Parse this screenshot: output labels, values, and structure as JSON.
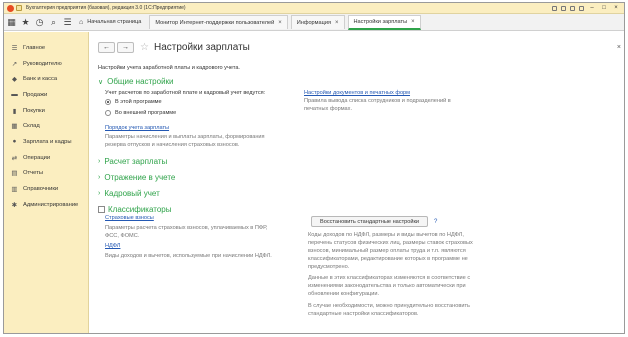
{
  "window": {
    "title": "Бухгалтерия предприятия (базовая), редакция 3.0  (1С:Предприятие)",
    "controls": [
      "–",
      "□",
      "×"
    ]
  },
  "toolbar": {
    "tabs": [
      {
        "label": "Начальная страница",
        "closable": false
      },
      {
        "label": "Монитор Интернет-поддержки пользователей",
        "closable": true
      },
      {
        "label": "Информация",
        "closable": true
      },
      {
        "label": "Настройки зарплаты",
        "closable": true,
        "active": true
      }
    ],
    "close_glyph": "×"
  },
  "sidebar": {
    "items": [
      {
        "label": "Главное",
        "icon": "menu-icon",
        "glyph": "☰"
      },
      {
        "label": "Руководителю",
        "icon": "chart-icon",
        "glyph": "↗"
      },
      {
        "label": "Банк и касса",
        "icon": "bank-icon",
        "glyph": "◆"
      },
      {
        "label": "Продажи",
        "icon": "cart-icon",
        "glyph": "▬"
      },
      {
        "label": "Покупки",
        "icon": "basket-icon",
        "glyph": "▮"
      },
      {
        "label": "Склад",
        "icon": "warehouse-icon",
        "glyph": "▦"
      },
      {
        "label": "Зарплата и кадры",
        "icon": "person-icon",
        "glyph": "●"
      },
      {
        "label": "Операции",
        "icon": "operations-icon",
        "glyph": "⇄"
      },
      {
        "label": "Отчеты",
        "icon": "reports-icon",
        "glyph": "▤"
      },
      {
        "label": "Справочники",
        "icon": "book-icon",
        "glyph": "▥"
      },
      {
        "label": "Администрирование",
        "icon": "gear-icon",
        "glyph": "✱"
      }
    ]
  },
  "main": {
    "nav": {
      "back": "←",
      "forward": "→",
      "star": "☆"
    },
    "title": "Настройки зарплаты",
    "close": "×",
    "intro": "Настройки учета заработной платы и кадрового учета.",
    "general": {
      "header": "Общие настройки",
      "prompt": "Учет расчетов по заработной плате и кадровый учет ведутся:",
      "options": [
        "В этой программе",
        "Во внешней программе"
      ],
      "selected_option": "В этой программе",
      "accounting_link": "Порядок учета зарплаты",
      "accounting_desc": [
        "Параметры начисления и выплаты зарплаты, формирования",
        "резерва отпусков и начисления страховых взносов."
      ],
      "docs_link": "Настройки документов и печатных форм",
      "docs_desc": [
        "Правила вывода списка сотрудников и подразделений в",
        "печатных формах."
      ]
    },
    "sections": [
      "Расчет зарплаты",
      "Отражение в учете",
      "Кадровый учет"
    ],
    "classifiers": {
      "header": "Классификаторы",
      "insurance_link": "Страховые взносы",
      "insurance_desc": [
        "Параметры расчета страховых взносов, уплачиваемых в ПФР,",
        "ФСС, ФОМС."
      ],
      "ndfl_link": "НДФЛ",
      "ndfl_desc": "Виды доходов и вычетов, используемые при начислении НДФЛ.",
      "restore_button": "Восстановить стандартные настройки",
      "help": "?",
      "info_1": [
        "Коды доходов по НДФЛ, размеры и виды вычетов по НДФЛ,",
        "перечень статусов физических лиц, размеры ставок страховых",
        "взносов, минимальный размер оплаты труда и т.п. являются",
        "классификаторами, редактирование которых в программе не",
        "предусмотрено."
      ],
      "info_2": [
        "Данные в этих классификаторах изменяются в соответствие с",
        "изменениями законодательства и только автоматически при",
        "обновлении конфигурации."
      ],
      "info_3": [
        "В случае необходимости, можно принудительно восстановить",
        "стандартные настройки классификаторов."
      ]
    }
  },
  "colors": {
    "accent_green": "#2fa34a",
    "link_blue": "#2358b3",
    "sidebar_bg": "#fbeec0"
  }
}
